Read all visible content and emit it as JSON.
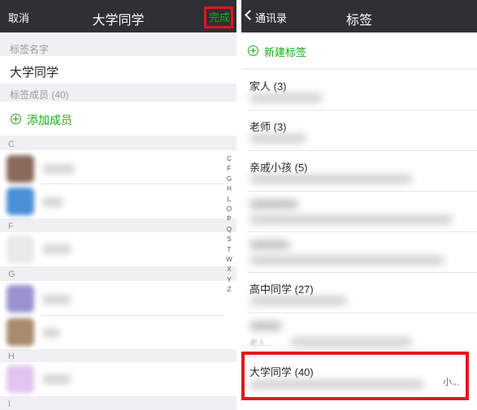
{
  "left": {
    "nav": {
      "cancel": "取消",
      "title": "大学同学",
      "done": "完成"
    },
    "tag_name_label": "标签名字",
    "tag_name_value": "大学同学",
    "members_label": "标签成员 (40)",
    "add_member": "添加成员",
    "groups": [
      "C",
      "F",
      "G",
      "H",
      "I"
    ],
    "index_letters": [
      "C",
      "F",
      "G",
      "H",
      "L",
      "O",
      "P",
      "Q",
      "S",
      "T",
      "W",
      "X",
      "Y",
      "Z"
    ]
  },
  "right": {
    "nav": {
      "back": "通讯录",
      "title": "标签"
    },
    "new_tag": "新建标签",
    "tags": [
      {
        "name": "家人 (3)"
      },
      {
        "name": "老师 (3)"
      },
      {
        "name": "亲戚小孩 (5)"
      },
      {
        "name": ""
      },
      {
        "name": ""
      },
      {
        "name": "高中同学 (27)"
      },
      {
        "name": "",
        "members": "老人..."
      },
      {
        "name": "大学同学 (40)",
        "members": "小..."
      }
    ]
  },
  "colors": {
    "accent_green": "#1aad19",
    "highlight_red": "#e8141b",
    "navbar": "#2f2f35"
  }
}
